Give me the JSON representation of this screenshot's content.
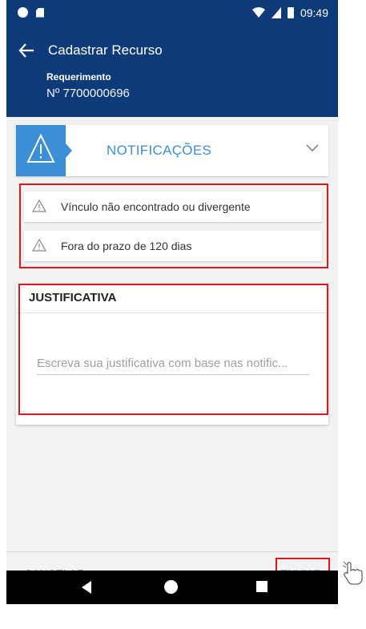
{
  "status_bar": {
    "time": "09:49"
  },
  "header": {
    "title": "Cadastrar Recurso",
    "requirement_label": "Requerimento",
    "requirement_number": "Nº  7700000696"
  },
  "notifications": {
    "title": "NOTIFICAÇÕES",
    "items": [
      {
        "text": "Vínculo não encontrado ou divergente"
      },
      {
        "text": "Fora do prazo de 120 dias"
      }
    ]
  },
  "justification": {
    "title": "JUSTIFICATIVA",
    "placeholder": "Escreva sua justificativa com base nas notific...",
    "value": ""
  },
  "actions": {
    "cancel_label": "CANCELAR",
    "send_label": "ENVIAR"
  },
  "colors": {
    "header_bg": "#0d3b7a",
    "accent": "#3a8fd6",
    "highlight": "#e0181e"
  },
  "icons": [
    "back-arrow-icon",
    "warning-icon",
    "chevron-down-icon",
    "hand-pointer-icon"
  ]
}
